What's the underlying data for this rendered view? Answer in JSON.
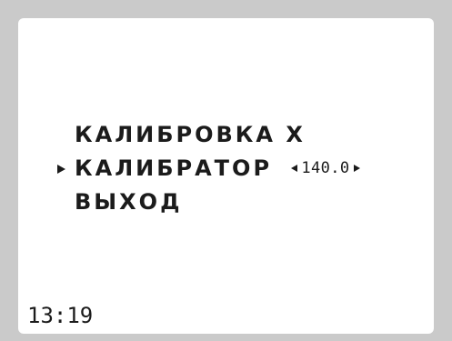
{
  "menu": {
    "title": "КАЛИБРОВКА X",
    "items": [
      {
        "label": "КАЛИБРАТОР",
        "value": "140.0",
        "selected": true,
        "left_arrow_icon": "triangle-left",
        "right_arrow_icon": "triangle-right"
      },
      {
        "label": "ВЫХОД",
        "selected": false
      }
    ]
  },
  "cursor_icon": "selection-triangle",
  "clock": "13:19",
  "colors": {
    "bezel": "#cacaca",
    "screen": "#ffffff",
    "text": "#1b1b1b"
  }
}
